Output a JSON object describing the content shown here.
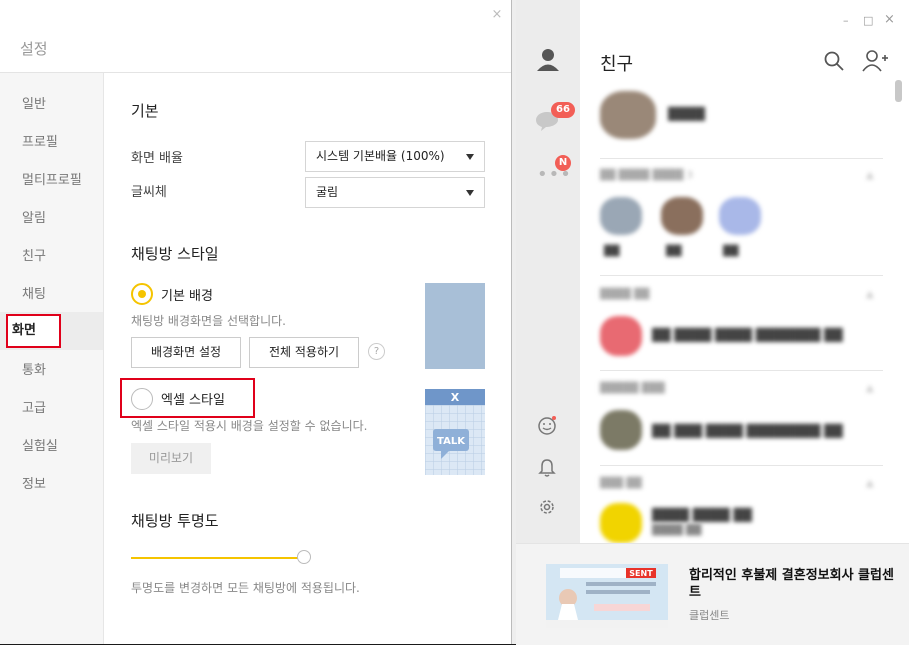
{
  "settings": {
    "title": "설정",
    "close_icon": "×",
    "sidebar": [
      {
        "label": "일반"
      },
      {
        "label": "프로필"
      },
      {
        "label": "멀티프로필"
      },
      {
        "label": "알림"
      },
      {
        "label": "친구"
      },
      {
        "label": "채팅"
      },
      {
        "label": "화면",
        "active": true
      },
      {
        "label": "통화"
      },
      {
        "label": "고급"
      },
      {
        "label": "실험실"
      },
      {
        "label": "정보"
      }
    ],
    "basic": {
      "title": "기본",
      "scale_label": "화면 배율",
      "scale_value": "시스템 기본배율 (100%)",
      "font_label": "글씨체",
      "font_value": "굴림"
    },
    "chat_style": {
      "title": "채팅방 스타일",
      "default_bg": "기본 배경",
      "default_bg_desc": "채팅방 배경화면을 선택합니다.",
      "btn_bg_setting": "배경화면 설정",
      "btn_apply_all": "전체 적용하기",
      "help": "?",
      "excel_style": "엑셀 스타일",
      "excel_desc": "엑셀 스타일 적용시 배경을 설정할 수 없습니다.",
      "btn_preview": "미리보기",
      "excel_icon_letter": "X",
      "talk_label": "TALK"
    },
    "transparency": {
      "title": "채팅방 투명도",
      "level": 1.0,
      "desc": "투명도를 변경하면 모든 채팅방에 적용됩니다."
    }
  },
  "main": {
    "title": "친구",
    "chat_badge": "66",
    "more_badge": "N",
    "window_controls": {
      "minimize": "–",
      "maximize": "□",
      "close": "×"
    },
    "blurred": {
      "my_name": "████",
      "section1": "██ ████ ████ 3",
      "fav_names": [
        "██",
        "██",
        "██"
      ],
      "section2": "████ ██",
      "row1": "██ ████ ████ ███████ ██",
      "section3": "█████ ███",
      "row2": "██ ███ ████ ████████ ██",
      "section4": "███ ██",
      "row3_title": "████ ████ ██",
      "row3_sub": "████ ██"
    },
    "ad": {
      "title": "합리적인 후불제 결혼정보회사 클럽센트",
      "sub": "클럽센트",
      "img_brand": "SENT"
    },
    "colors": {
      "accent": "#f5c400",
      "badge": "#f25e56",
      "highlight": "#e0001a"
    }
  }
}
